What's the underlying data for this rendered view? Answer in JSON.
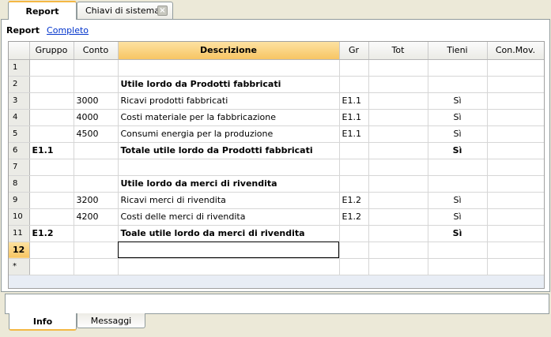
{
  "tabs": {
    "report": "Report",
    "chiavi": "Chiavi di sistema",
    "close_glyph": "×"
  },
  "subbar": {
    "label": "Report",
    "link": "Completo"
  },
  "grid": {
    "columns": [
      "Gruppo",
      "Conto",
      "Descrizione",
      "Gr",
      "Tot",
      "Tieni",
      "Con.Mov."
    ],
    "rows": [
      {
        "n": "1",
        "gruppo": "",
        "conto": "",
        "descr": "",
        "gr": "",
        "tot": "",
        "tieni": "",
        "conmov": ""
      },
      {
        "n": "2",
        "gruppo": "",
        "conto": "",
        "descr": "Utile lordo da Prodotti fabbricati",
        "gr": "",
        "tot": "",
        "tieni": "",
        "conmov": ""
      },
      {
        "n": "3",
        "gruppo": "",
        "conto": "3000",
        "descr": "Ricavi prodotti fabbricati",
        "gr": "E1.1",
        "tot": "",
        "tieni": "Sì",
        "conmov": ""
      },
      {
        "n": "4",
        "gruppo": "",
        "conto": "4000",
        "descr": "Costi materiale per la fabbricazione",
        "gr": "E1.1",
        "tot": "",
        "tieni": "Sì",
        "conmov": ""
      },
      {
        "n": "5",
        "gruppo": "",
        "conto": "4500",
        "descr": "Consumi energia per la produzione",
        "gr": "E1.1",
        "tot": "",
        "tieni": "Sì",
        "conmov": ""
      },
      {
        "n": "6",
        "gruppo": "E1.1",
        "conto": "",
        "descr": "Totale utile lordo da Prodotti fabbricati",
        "gr": "",
        "tot": "",
        "tieni": "Sì",
        "conmov": ""
      },
      {
        "n": "7",
        "gruppo": "",
        "conto": "",
        "descr": "",
        "gr": "",
        "tot": "",
        "tieni": "",
        "conmov": ""
      },
      {
        "n": "8",
        "gruppo": "",
        "conto": "",
        "descr": "Utile lordo da merci di rivendita",
        "gr": "",
        "tot": "",
        "tieni": "",
        "conmov": ""
      },
      {
        "n": "9",
        "gruppo": "",
        "conto": "3200",
        "descr": "Ricavi merci di rivendita",
        "gr": "E1.2",
        "tot": "",
        "tieni": "Sì",
        "conmov": ""
      },
      {
        "n": "10",
        "gruppo": "",
        "conto": "4200",
        "descr": "Costi delle merci di rivendita",
        "gr": "E1.2",
        "tot": "",
        "tieni": "Sì",
        "conmov": ""
      },
      {
        "n": "11",
        "gruppo": "E1.2",
        "conto": "",
        "descr": "Toale utile lordo da merci di rivendita",
        "gr": "",
        "tot": "",
        "tieni": "Sì",
        "conmov": ""
      },
      {
        "n": "12",
        "gruppo": "",
        "conto": "",
        "descr": "",
        "gr": "",
        "tot": "",
        "tieni": "",
        "conmov": ""
      },
      {
        "n": "*",
        "gruppo": "",
        "conto": "",
        "descr": "",
        "gr": "",
        "tot": "",
        "tieni": "",
        "conmov": ""
      }
    ]
  },
  "bottom_tabs": {
    "info": "Info",
    "messaggi": "Messaggi"
  },
  "colors": {
    "accent": "#f4b844",
    "selected_header": "#f7c563",
    "link": "#0033cc"
  }
}
